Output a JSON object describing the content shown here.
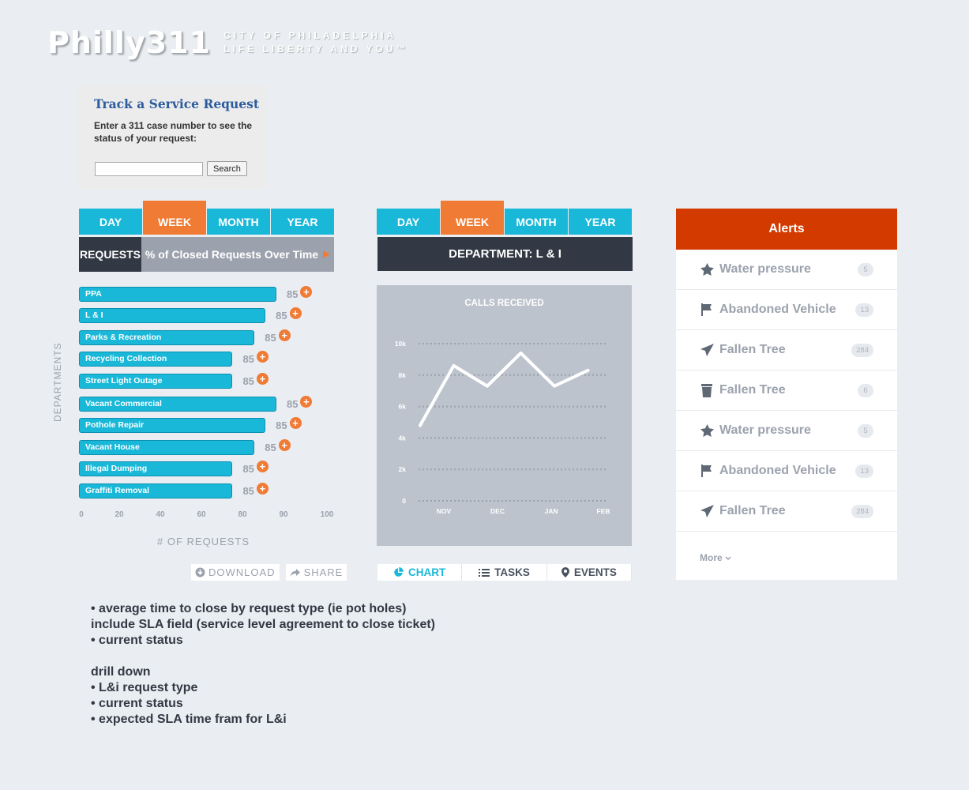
{
  "header": {
    "logo_main": "Philly311",
    "logo_line1": "CITY OF PHILADELPHIA",
    "logo_line2": "LIFE LIBERTY AND YOU™"
  },
  "track": {
    "title": "Track a Service Request",
    "description": "Enter a 311 case number to see the status of your request:",
    "input_value": "",
    "search_label": "Search"
  },
  "left_tabs": [
    {
      "label": "DAY",
      "active": false
    },
    {
      "label": "WEEK",
      "active": true
    },
    {
      "label": "MONTH",
      "active": false
    },
    {
      "label": "YEAR",
      "active": false
    }
  ],
  "requests_panel": {
    "tab_requests": "REQUESTS",
    "tab_closed": "% of Closed Requests Over Time",
    "ylabel": "DEPARTMENTS",
    "xlabel": "# OF REQUESTS",
    "download_label": "DOWNLOAD",
    "share_label": "SHARE"
  },
  "chart_data": [
    {
      "type": "bar",
      "orientation": "horizontal",
      "categories": [
        "PPA",
        "L & I",
        "Parks & Recreation",
        "Recycling Collection",
        "Street Light Outage",
        "Vacant Commercial",
        "Pothole Repair",
        "Vacant House",
        "Illegal Dumping",
        "Graffiti Removal"
      ],
      "values": [
        90,
        85,
        80,
        70,
        70,
        90,
        85,
        80,
        70,
        70
      ],
      "value_labels": [
        "85",
        "85",
        "85",
        "85",
        "85",
        "85",
        "85",
        "85",
        "85",
        "85"
      ],
      "xticks": [
        "0",
        "20",
        "40",
        "60",
        "80",
        "90",
        "100"
      ],
      "xtick_values": [
        0,
        20,
        40,
        60,
        80,
        90,
        100
      ],
      "xlabel": "# OF REQUESTS",
      "ylabel": "DEPARTMENTS",
      "xlim": [
        0,
        100
      ]
    },
    {
      "type": "line",
      "title": "CALLS RECEIVED",
      "x": [
        0,
        1,
        2,
        3,
        4,
        5,
        6
      ],
      "values": [
        4800,
        8600,
        7300,
        9400,
        7300,
        8300
      ],
      "xticks": [
        "NOV",
        "DEC",
        "JAN",
        "FEB"
      ],
      "yticks": [
        "0",
        "2k",
        "4k",
        "6k",
        "8k",
        "10k"
      ],
      "ylim": [
        0,
        10000
      ],
      "grid": true
    }
  ],
  "mid_tabs": [
    {
      "label": "DAY",
      "active": false
    },
    {
      "label": "WEEK",
      "active": true
    },
    {
      "label": "MONTH",
      "active": false
    },
    {
      "label": "YEAR",
      "active": false
    }
  ],
  "department": {
    "title": "DEPARTMENT: L & I"
  },
  "chart_tabs": [
    {
      "label": "CHART",
      "icon": "pie-icon",
      "active": true
    },
    {
      "label": "TASKS",
      "icon": "list-icon",
      "active": false
    },
    {
      "label": "EVENTS",
      "icon": "pin-icon",
      "active": false
    }
  ],
  "alerts": {
    "title": "Alerts",
    "more": "More",
    "items": [
      {
        "label": "Water pressure",
        "count": "5",
        "icon": "star-icon"
      },
      {
        "label": "Abandoned Vehicle",
        "count": "13",
        "icon": "flag-icon"
      },
      {
        "label": "Fallen Tree",
        "count": "284",
        "icon": "send-icon"
      },
      {
        "label": "Fallen Tree",
        "count": "6",
        "icon": "trash-icon"
      },
      {
        "label": "Water pressure",
        "count": "5",
        "icon": "star-icon"
      },
      {
        "label": "Abandoned Vehicle",
        "count": "13",
        "icon": "flag-icon"
      },
      {
        "label": "Fallen Tree",
        "count": "284",
        "icon": "send-icon"
      }
    ]
  },
  "colors": {
    "cyan": "#19b8d8",
    "orange": "#f07b35",
    "dark": "#333944",
    "alert_red": "#d23a00",
    "gray": "#9ca2ad"
  },
  "notes": [
    "• average time to close by request type (ie pot holes)",
    "include SLA field (service level agreement to close ticket)",
    "• current status",
    "",
    "drill down",
    "• L&i request type",
    "• current status",
    "• expected SLA time fram for L&i"
  ]
}
